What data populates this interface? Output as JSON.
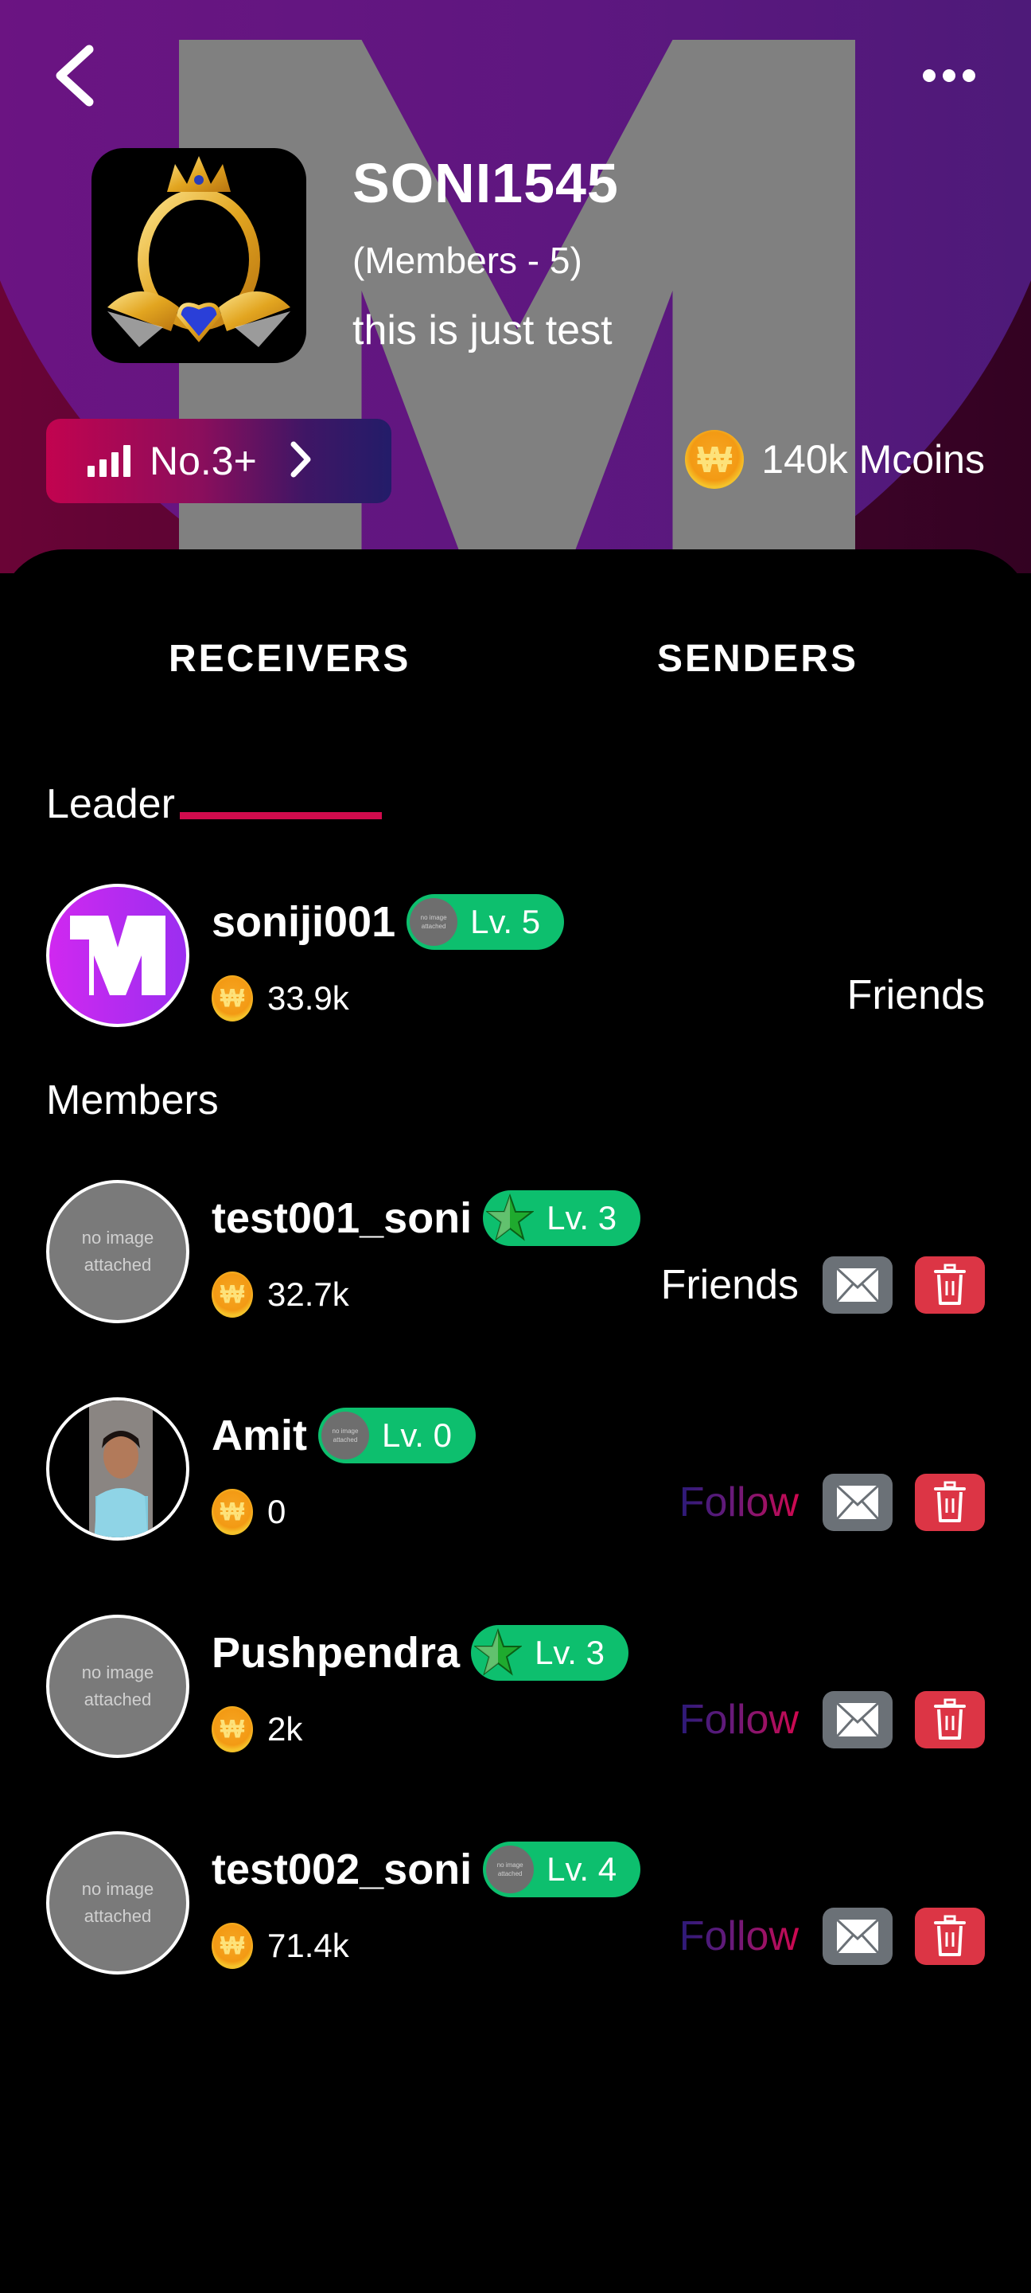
{
  "header": {
    "back_icon": "chevron-left-icon",
    "more_icon": "more-horizontal-icon",
    "group_name": "SONI1545",
    "members_text": "(Members - 5)",
    "description": "this is just test",
    "rank_label": "No.3+",
    "mcoins_text": "140k Mcoins"
  },
  "tabs": [
    {
      "label": "RECEIVERS",
      "active": true
    },
    {
      "label": "SENDERS",
      "active": false
    }
  ],
  "colors": {
    "accent": "#d10b4d",
    "level_badge": "#0dbf6e",
    "mail_button": "#6b7177",
    "delete_button": "#dc3545"
  },
  "leader": {
    "section_title": "Leader",
    "name": "soniji001",
    "level": "Lv. 5",
    "level_icon": "no image attached",
    "coins": "33.9k",
    "status": "Friends",
    "avatar": "brand-logo"
  },
  "members": {
    "section_title": "Members",
    "no_image_text": "no image attached",
    "items": [
      {
        "name": "test001_soni",
        "level": "Lv. 3",
        "level_icon": "star",
        "coins": "32.7k",
        "status": "Friends",
        "avatar": "no-image"
      },
      {
        "name": "Amit",
        "level": "Lv. 0",
        "level_icon": "no image attached",
        "coins": "0",
        "status": "Follow",
        "avatar": "photo"
      },
      {
        "name": "Pushpendra",
        "level": "Lv. 3",
        "level_icon": "star",
        "coins": "2k",
        "status": "Follow",
        "avatar": "no-image"
      },
      {
        "name": "test002_soni",
        "level": "Lv. 4",
        "level_icon": "no image attached",
        "coins": "71.4k",
        "status": "Follow",
        "avatar": "no-image"
      }
    ]
  }
}
